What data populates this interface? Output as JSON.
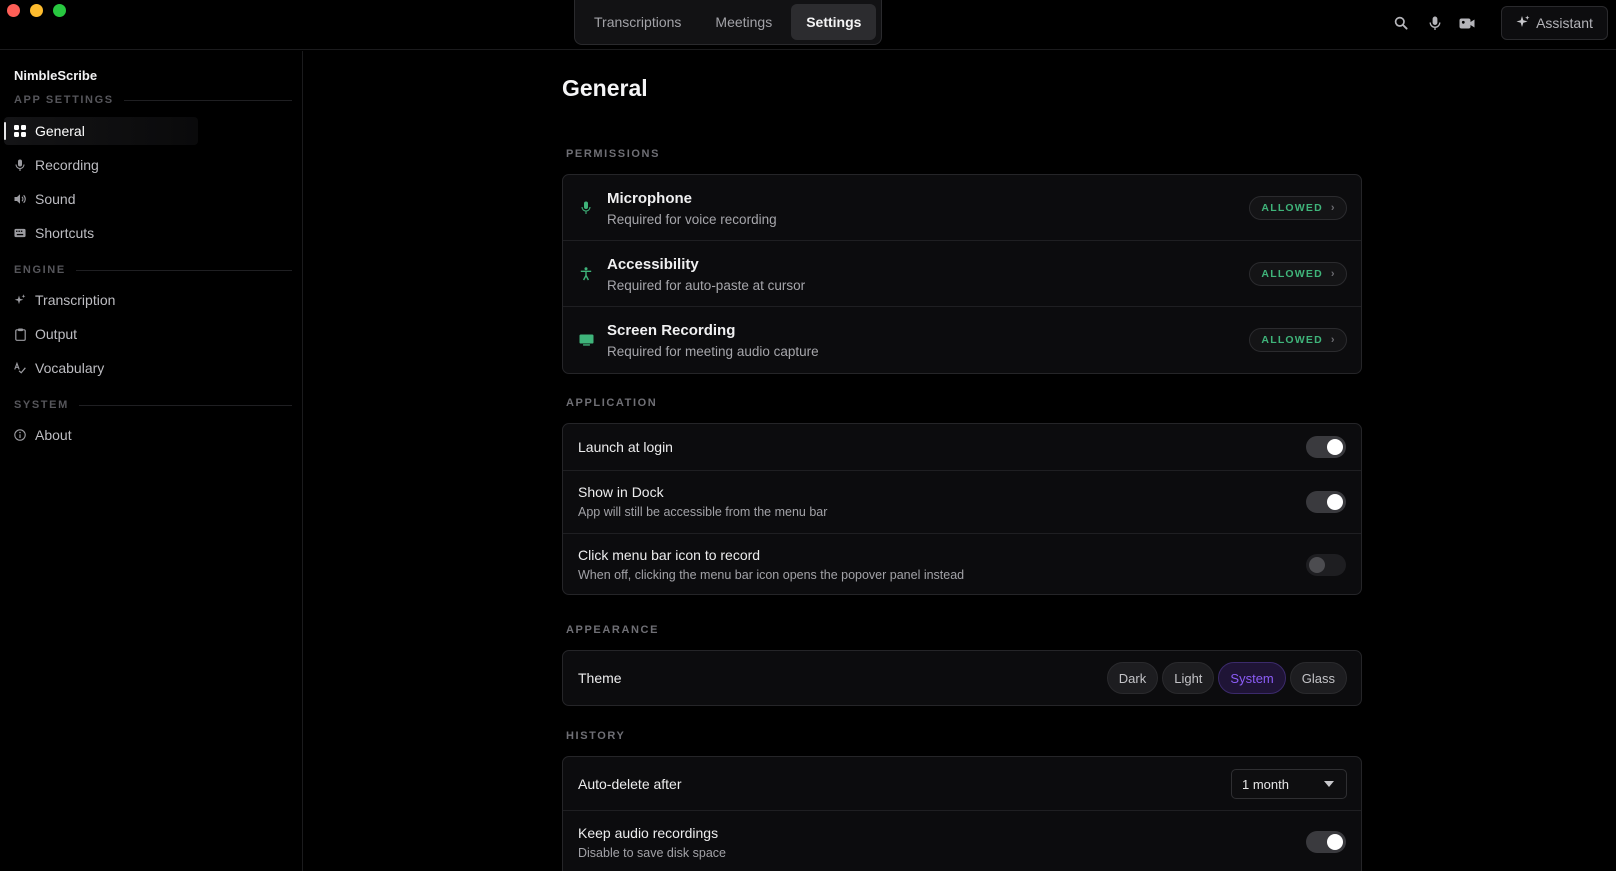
{
  "topbar": {
    "tabs": [
      {
        "label": "Transcriptions"
      },
      {
        "label": "Meetings"
      },
      {
        "label": "Settings"
      }
    ],
    "active_tab": "Settings",
    "icons": [
      "search-icon",
      "microphone-icon",
      "video-camera-icon"
    ],
    "assistant_label": "Assistant"
  },
  "sidebar": {
    "app_name": "NimbleScribe",
    "sections": [
      {
        "title": "APP SETTINGS",
        "items": [
          {
            "label": "General",
            "icon": "grid-icon",
            "active": true
          },
          {
            "label": "Recording",
            "icon": "microphone-icon"
          },
          {
            "label": "Sound",
            "icon": "speaker-icon"
          },
          {
            "label": "Shortcuts",
            "icon": "keyboard-icon"
          }
        ]
      },
      {
        "title": "ENGINE",
        "items": [
          {
            "label": "Transcription",
            "icon": "sparkles-icon"
          },
          {
            "label": "Output",
            "icon": "clipboard-icon"
          },
          {
            "label": "Vocabulary",
            "icon": "spellcheck-icon"
          }
        ]
      },
      {
        "title": "SYSTEM",
        "items": [
          {
            "label": "About",
            "icon": "info-icon"
          }
        ]
      }
    ]
  },
  "main": {
    "title": "General",
    "permissions": {
      "heading": "PERMISSIONS",
      "items": [
        {
          "title": "Microphone",
          "subtitle": "Required for voice recording",
          "status": "ALLOWED",
          "icon": "microphone-icon"
        },
        {
          "title": "Accessibility",
          "subtitle": "Required for auto-paste at cursor",
          "status": "ALLOWED",
          "icon": "accessibility-icon"
        },
        {
          "title": "Screen Recording",
          "subtitle": "Required for meeting audio capture",
          "status": "ALLOWED",
          "icon": "screen-icon"
        }
      ]
    },
    "application": {
      "heading": "APPLICATION",
      "items": [
        {
          "title": "Launch at login",
          "subtitle": "",
          "on": true
        },
        {
          "title": "Show in Dock",
          "subtitle": "App will still be accessible from the menu bar",
          "on": true
        },
        {
          "title": "Click menu bar icon to record",
          "subtitle": "When off, clicking the menu bar icon opens the popover panel instead",
          "on": false
        }
      ]
    },
    "appearance": {
      "heading": "APPEARANCE",
      "theme_label": "Theme",
      "options": [
        "Dark",
        "Light",
        "System",
        "Glass"
      ],
      "selected": "System"
    },
    "history": {
      "heading": "HISTORY",
      "auto_delete_label": "Auto-delete after",
      "auto_delete_value": "1 month",
      "keep_audio_title": "Keep audio recordings",
      "keep_audio_subtitle": "Disable to save disk space",
      "keep_audio_on": true
    }
  },
  "colors": {
    "accent_allowed": "#3fb47a",
    "accent_theme": "#8b5cf6",
    "background": "#000000"
  }
}
